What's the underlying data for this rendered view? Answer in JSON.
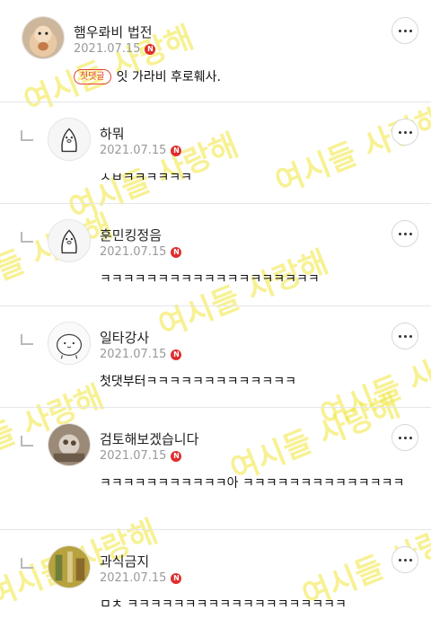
{
  "comments": [
    {
      "name": "햄우롸비 법전",
      "date": "2021.07.15",
      "badge": "N",
      "first_label": "첫댓글",
      "text": "잇 가라비 후로훼사."
    },
    {
      "name": "하뭐",
      "date": "2021.07.15",
      "badge": "N",
      "text": "ㅅㅂㅋㅋㅋㅋㅋㅋ"
    },
    {
      "name": "훈민킹정음",
      "date": "2021.07.15",
      "badge": "N",
      "text": "ㅋㅋㅋㅋㅋㅋㅋㅋㅋㅋㅋㅋㅋㅋㅋㅋㅋㅋㅋ"
    },
    {
      "name": "일타강사",
      "date": "2021.07.15",
      "badge": "N",
      "text": "첫댓부터ㅋㅋㅋㅋㅋㅋㅋㅋㅋㅋㅋㅋㅋ"
    },
    {
      "name": "검토해보겠습니다",
      "date": "2021.07.15",
      "badge": "N",
      "text": "ㅋㅋㅋㅋㅋㅋㅋㅋㅋㅋㅋ아 ㅋㅋㅋㅋㅋㅋㅋㅋㅋㅋㅋㅋㅋㅋ"
    },
    {
      "name": "과식금지",
      "date": "2021.07.15",
      "badge": "N",
      "text": "ㅁㅊ ㅋㅋㅋㅋㅋㅋㅋㅋㅋㅋㅋㅋㅋㅋㅋㅋㅋㅋㅋ"
    }
  ],
  "watermark_text": "여시들 사랑해",
  "colors": {
    "badge": "#e02d2d",
    "watermark": "#f0e63c",
    "divider": "#e6e6e6"
  },
  "icons": {
    "more": "more-dots-icon",
    "reply": "reply-arrow-icon",
    "new": "new-badge-icon"
  }
}
